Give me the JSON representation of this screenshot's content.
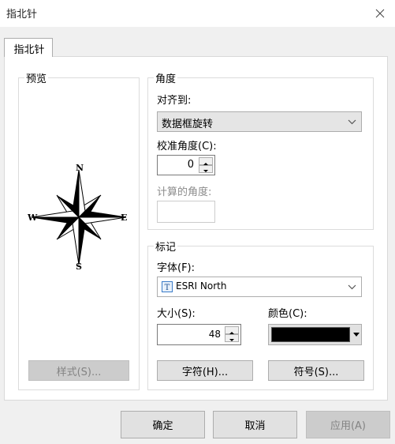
{
  "window": {
    "title": "指北针"
  },
  "tabs": [
    {
      "label": "指北针"
    }
  ],
  "preview": {
    "group_title": "预览",
    "compass_labels": {
      "n": "N",
      "s": "S",
      "e": "E",
      "w": "W"
    },
    "style_button": "样式(S)..."
  },
  "angle": {
    "group_title": "角度",
    "align_label": "对齐到:",
    "align_value": "数据框旋转",
    "calibration_label": "校准角度(C):",
    "calibration_value": "0",
    "calculated_label": "计算的角度:",
    "calculated_value": ""
  },
  "marker": {
    "group_title": "标记",
    "font_label": "字体(F):",
    "font_value": "ESRI North",
    "size_label": "大小(S):",
    "size_value": "48",
    "color_label": "颜色(C):",
    "color_value": "#000000",
    "char_button": "字符(H)...",
    "symbol_button": "符号(S)..."
  },
  "footer": {
    "ok": "确定",
    "cancel": "取消",
    "apply": "应用(A)"
  }
}
